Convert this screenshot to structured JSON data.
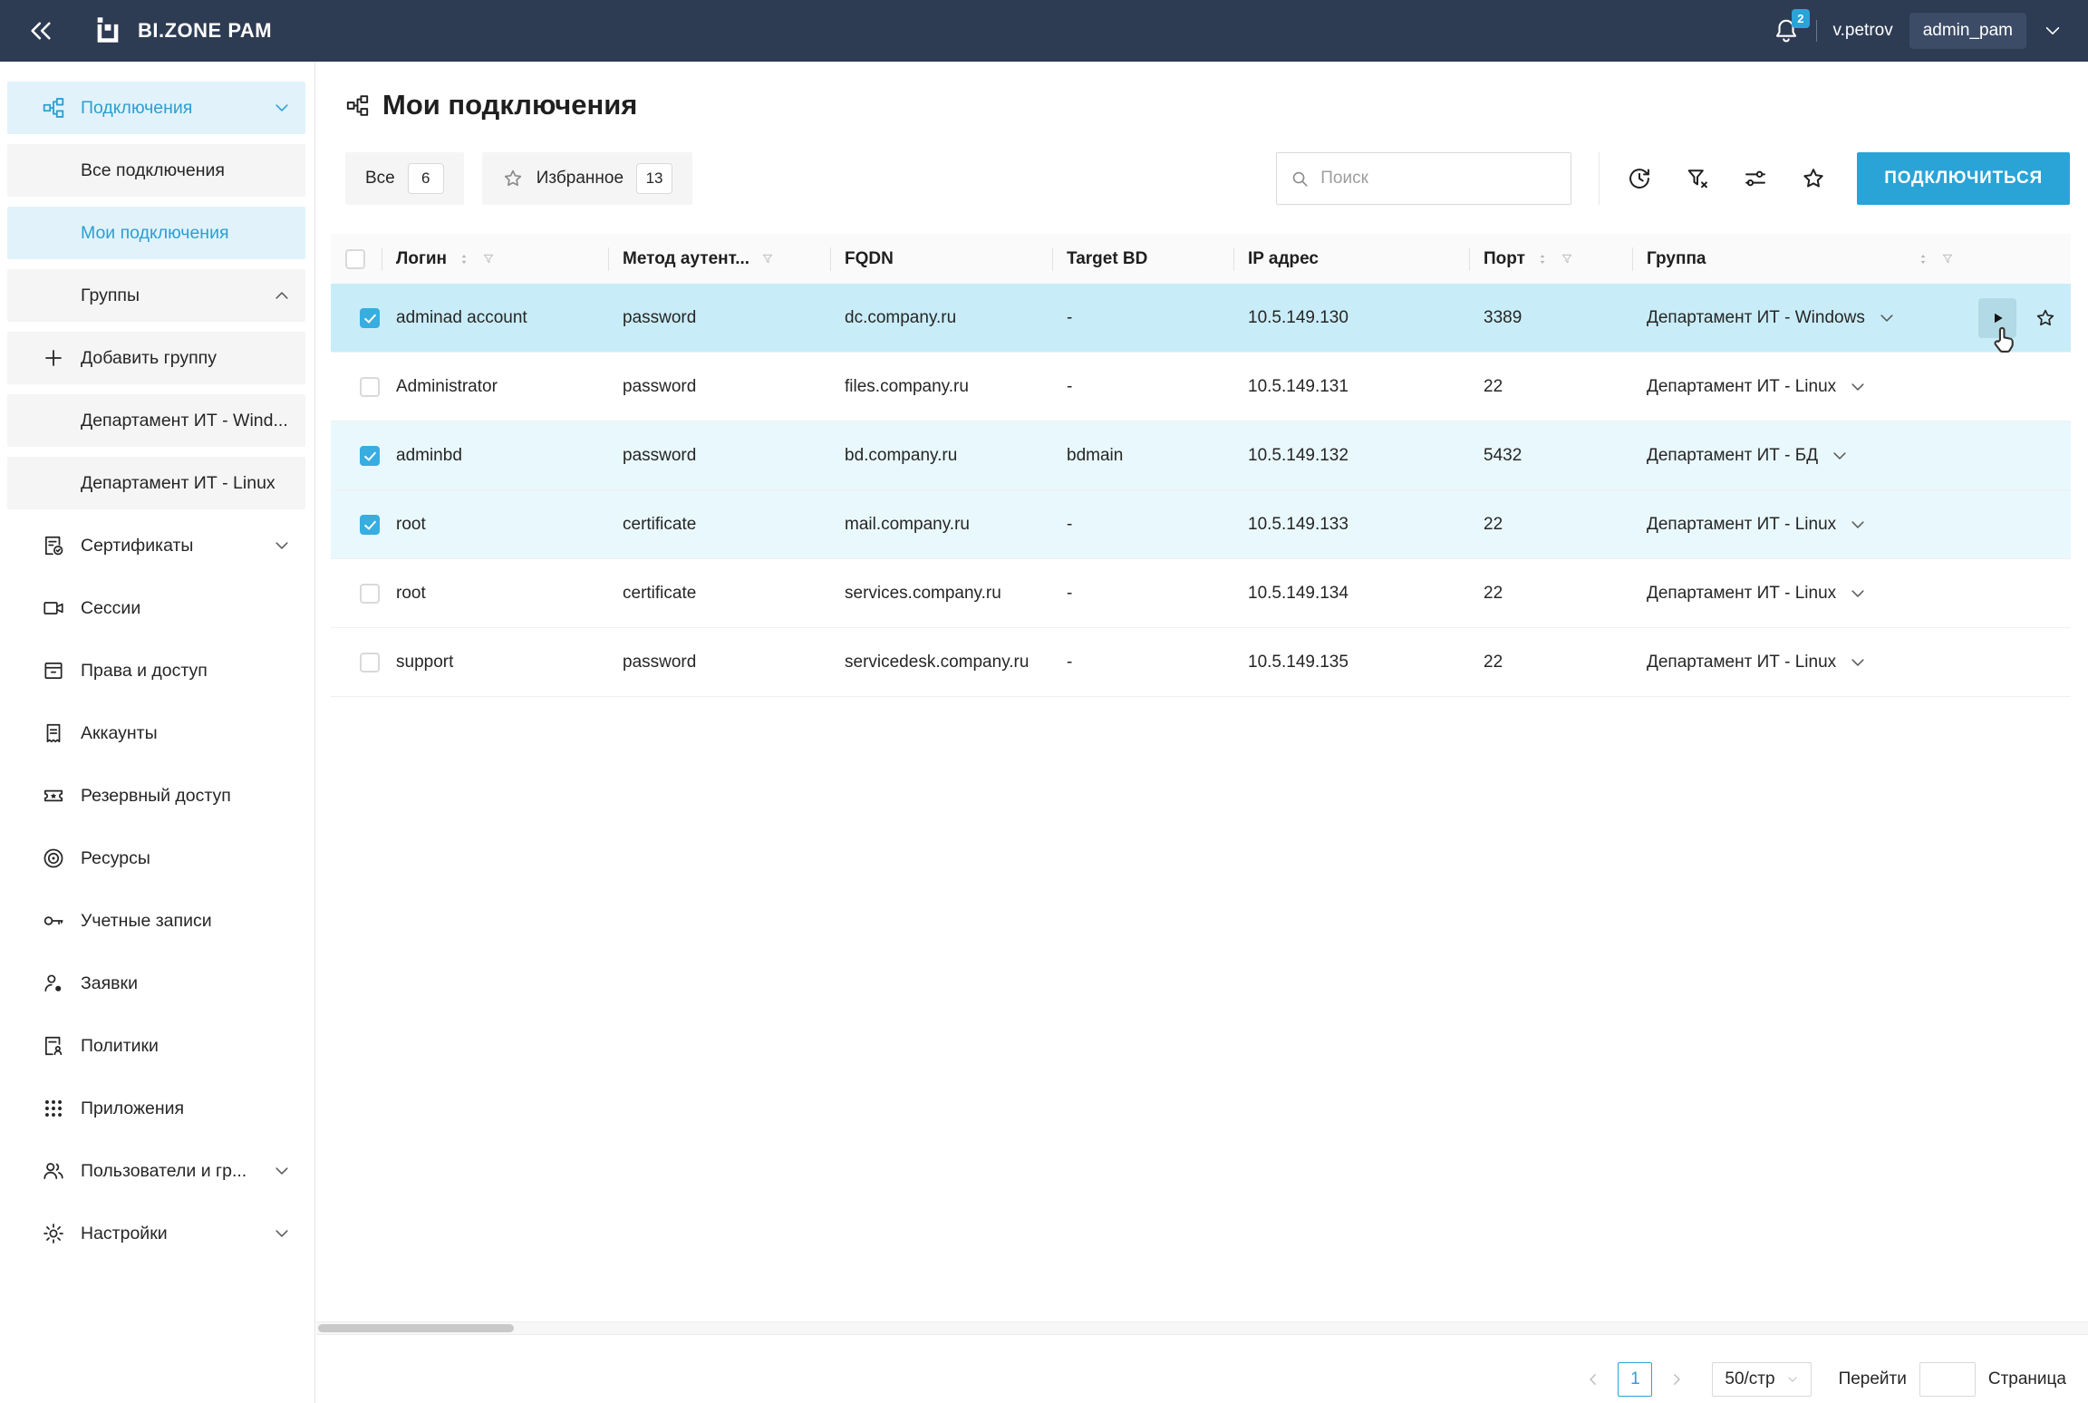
{
  "topbar": {
    "app_title": "BI.ZONE PAM",
    "notifications_count": "2",
    "username": "v.petrov",
    "role": "admin_pam"
  },
  "sidebar": {
    "items": [
      {
        "label": "Подключения"
      },
      {
        "label": "Все подключения"
      },
      {
        "label": "Мои подключения"
      },
      {
        "label": "Группы"
      },
      {
        "label": "Добавить группу"
      },
      {
        "label": "Департамент ИТ - Wind..."
      },
      {
        "label": "Департамент ИТ - Linux"
      },
      {
        "label": "Сертификаты"
      },
      {
        "label": "Сессии"
      },
      {
        "label": "Права и доступ"
      },
      {
        "label": "Аккаунты"
      },
      {
        "label": "Резервный доступ"
      },
      {
        "label": "Ресурсы"
      },
      {
        "label": "Учетные записи"
      },
      {
        "label": "Заявки"
      },
      {
        "label": "Политики"
      },
      {
        "label": "Приложения"
      },
      {
        "label": "Пользователи и гр..."
      },
      {
        "label": "Настройки"
      }
    ]
  },
  "page": {
    "title": "Мои подключения",
    "filter_all_label": "Все",
    "filter_all_count": "6",
    "filter_fav_label": "Избранное",
    "filter_fav_count": "13",
    "search_placeholder": "Поиск",
    "connect_button": "ПОДКЛЮЧИТЬСЯ"
  },
  "table": {
    "columns": [
      "Логин",
      "Метод аутент...",
      "FQDN",
      "Target BD",
      "IP адрес",
      "Порт",
      "Группа"
    ],
    "rows": [
      {
        "checked": true,
        "state": "selected",
        "login": "adminad account",
        "method": "password",
        "fqdn": "dc.company.ru",
        "target": "-",
        "ip": "10.5.149.130",
        "port": "3389",
        "group": "Департамент ИТ - Windows"
      },
      {
        "checked": false,
        "state": "",
        "login": "Administrator",
        "method": "password",
        "fqdn": "files.company.ru",
        "target": "-",
        "ip": "10.5.149.131",
        "port": "22",
        "group": "Департамент ИТ - Linux"
      },
      {
        "checked": true,
        "state": "checked",
        "login": "adminbd",
        "method": "password",
        "fqdn": "bd.company.ru",
        "target": "bdmain",
        "ip": "10.5.149.132",
        "port": "5432",
        "group": "Департамент ИТ - БД"
      },
      {
        "checked": true,
        "state": "checked",
        "login": "root",
        "method": "certificate",
        "fqdn": "mail.company.ru",
        "target": "-",
        "ip": "10.5.149.133",
        "port": "22",
        "group": "Департамент ИТ - Linux"
      },
      {
        "checked": false,
        "state": "",
        "login": "root",
        "method": "certificate",
        "fqdn": "services.company.ru",
        "target": "-",
        "ip": "10.5.149.134",
        "port": "22",
        "group": "Департамент ИТ - Linux"
      },
      {
        "checked": false,
        "state": "",
        "login": "support",
        "method": "password",
        "fqdn": "servicedesk.company.ru",
        "target": "-",
        "ip": "10.5.149.135",
        "port": "22",
        "group": "Департамент ИТ - Linux"
      }
    ]
  },
  "pagination": {
    "current_page": "1",
    "page_size": "50/стр",
    "goto_label": "Перейти",
    "page_label": "Страница"
  },
  "colors": {
    "accent": "#2aa3d7",
    "topbar_bg": "#2d3b53",
    "row_selected": "#c9edf8",
    "row_checked": "#e9f8fc",
    "sidebar_active_bg": "#e1f2fa"
  }
}
